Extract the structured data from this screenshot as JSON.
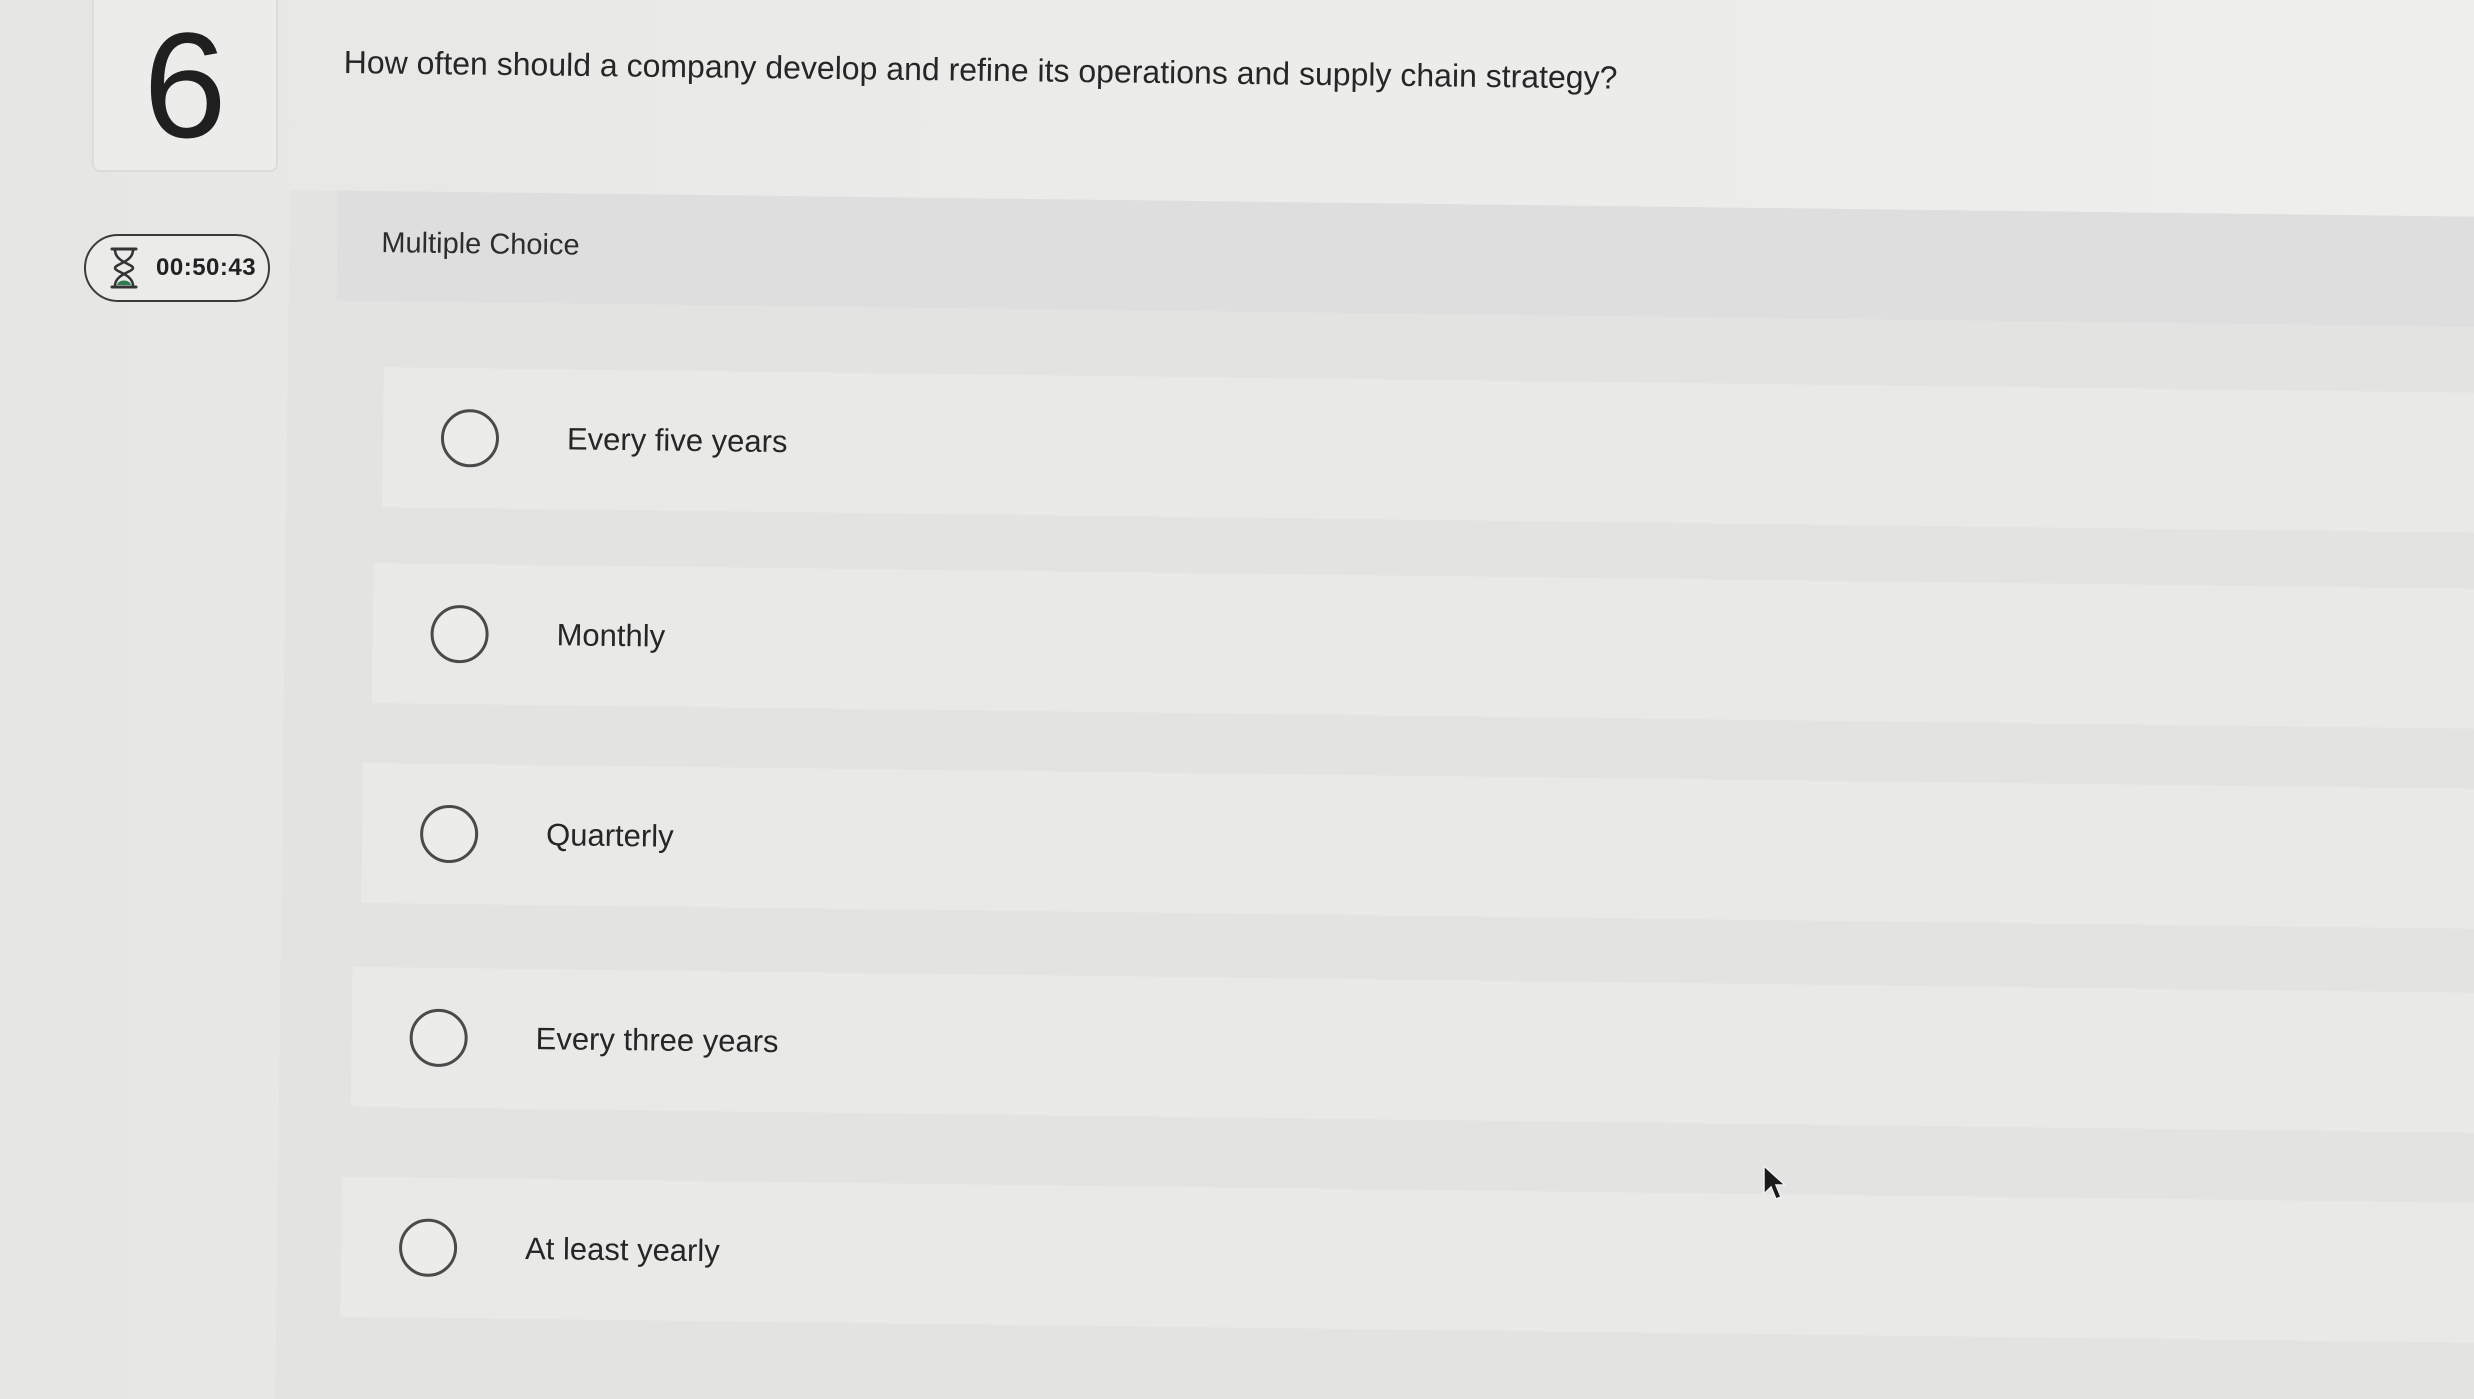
{
  "question_number": "6",
  "timer": {
    "icon": "hourglass-icon",
    "time": "00:50:43"
  },
  "question": {
    "text": "How often should a company develop and refine its operations and supply chain strategy?"
  },
  "answer_section": {
    "type_label": "Multiple Choice",
    "options": [
      {
        "label": "Every five years",
        "selected": false
      },
      {
        "label": "Monthly",
        "selected": false
      },
      {
        "label": "Quarterly",
        "selected": false
      },
      {
        "label": "Every three years",
        "selected": false
      },
      {
        "label": "At least yearly",
        "selected": false
      }
    ]
  },
  "colors": {
    "background": "#e9e9e7",
    "option_background": "#e9e9e7",
    "header_background": "#dedede",
    "text": "#262626",
    "timer_icon_accent": "#2e7d4f"
  }
}
